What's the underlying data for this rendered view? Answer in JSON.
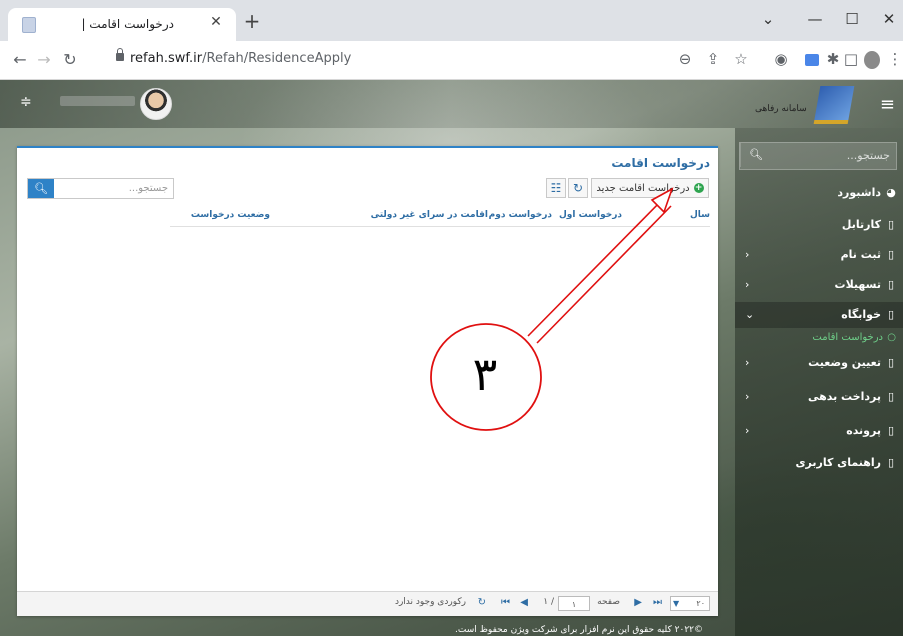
{
  "browser": {
    "tab_title": "درخواست اقامت |",
    "tab_close": "✕",
    "new_tab": "+",
    "url_host": "refah.swf.ir",
    "url_path": "/Refah/ResidenceApply",
    "window_minimize": "—",
    "window_maximize": "☐",
    "window_close": "✕",
    "window_menu": "⌄"
  },
  "header": {
    "logo_text": "سامانه رفاهی"
  },
  "sidebar": {
    "search_placeholder": "جستجو...",
    "items": [
      {
        "label": "داشبورد",
        "icon": "dashboard-icon",
        "chevron": ""
      },
      {
        "label": "کارتابل",
        "icon": "folder-icon",
        "chevron": ""
      },
      {
        "label": "ثبت نام",
        "icon": "folder-icon",
        "chevron": "‹"
      },
      {
        "label": "تسهیلات",
        "icon": "folder-icon",
        "chevron": "‹"
      },
      {
        "label": "خوابگاه",
        "icon": "folder-icon",
        "chevron": "⌄"
      },
      {
        "label": "تعیین وضعیت",
        "icon": "folder-icon",
        "chevron": "‹"
      },
      {
        "label": "پرداخت بدهی",
        "icon": "folder-icon",
        "chevron": "‹"
      },
      {
        "label": "پرونده",
        "icon": "folder-icon",
        "chevron": "‹"
      },
      {
        "label": "راهنمای کاربری",
        "icon": "folder-icon",
        "chevron": ""
      }
    ],
    "sub_item": "درخواست اقامت"
  },
  "card": {
    "title": "درخواست اقامت",
    "new_button": "درخواست اقامت جدید",
    "search_placeholder": "جستجو...",
    "columns": [
      "سال",
      "درخواست اول",
      "درخواست دوم",
      "اقامت در سرای غیر دولتی",
      "وضعیت درخواست"
    ]
  },
  "pager": {
    "page_size": "۲۰",
    "page_label": "صفحه",
    "page_value": "۱",
    "page_of": "/ ۱",
    "empty_text": "رکوردی وجود ندارد"
  },
  "annotation": {
    "number": "۳"
  },
  "footer": {
    "text": "©۲۰۲۲ کلیه حقوق این نرم افزار برای شرکت ویژن محفوظ است."
  },
  "colors": {
    "accent": "#2e82c7",
    "header_text": "#2e6da4",
    "active_sub": "#6fd08a",
    "annotation": "#e01010"
  }
}
